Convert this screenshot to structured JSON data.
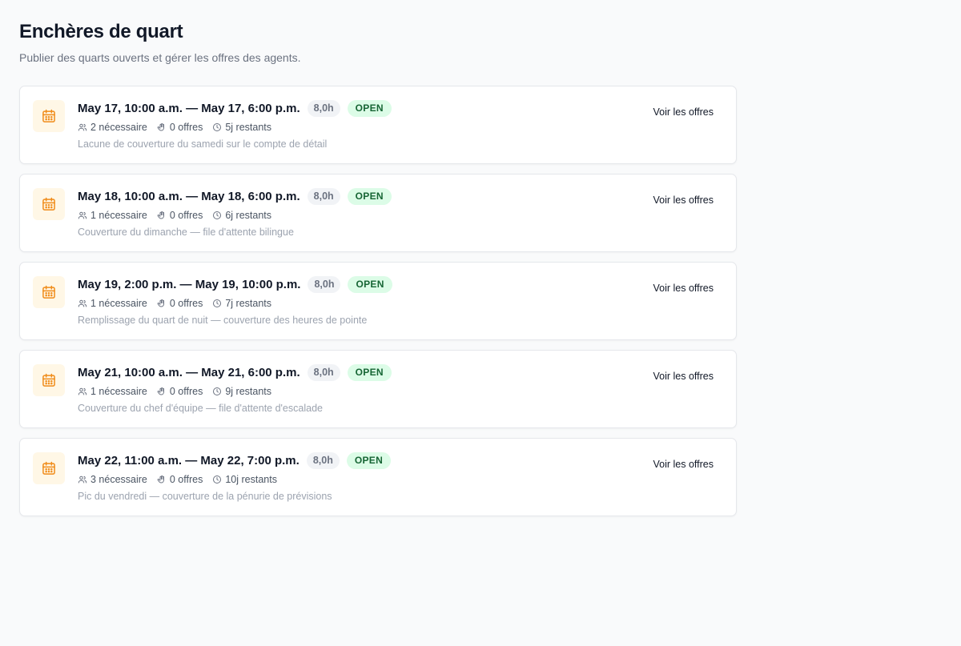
{
  "header": {
    "title": "Enchères de quart",
    "subtitle": "Publier des quarts ouverts et gérer les offres des agents."
  },
  "colors": {
    "accent_icon": "#f08c1a",
    "icon_bg": "#fff7e6",
    "open_bg": "#dcfce7",
    "open_text": "#166534"
  },
  "shifts": [
    {
      "title": "May 17, 10:00 a.m. — May 17, 6:00 p.m.",
      "hours": "8,0h",
      "status": "OPEN",
      "needed": "2 nécessaire",
      "offers": "0 offres",
      "remaining": "5j restants",
      "note": "Lacune de couverture du samedi sur le compte de détail",
      "action": "Voir les offres"
    },
    {
      "title": "May 18, 10:00 a.m. — May 18, 6:00 p.m.",
      "hours": "8,0h",
      "status": "OPEN",
      "needed": "1 nécessaire",
      "offers": "0 offres",
      "remaining": "6j restants",
      "note": "Couverture du dimanche — file d'attente bilingue",
      "action": "Voir les offres"
    },
    {
      "title": "May 19, 2:00 p.m. — May 19, 10:00 p.m.",
      "hours": "8,0h",
      "status": "OPEN",
      "needed": "1 nécessaire",
      "offers": "0 offres",
      "remaining": "7j restants",
      "note": "Remplissage du quart de nuit — couverture des heures de pointe",
      "action": "Voir les offres"
    },
    {
      "title": "May 21, 10:00 a.m. — May 21, 6:00 p.m.",
      "hours": "8,0h",
      "status": "OPEN",
      "needed": "1 nécessaire",
      "offers": "0 offres",
      "remaining": "9j restants",
      "note": "Couverture du chef d'équipe — file d'attente d'escalade",
      "action": "Voir les offres"
    },
    {
      "title": "May 22, 11:00 a.m. — May 22, 7:00 p.m.",
      "hours": "8,0h",
      "status": "OPEN",
      "needed": "3 nécessaire",
      "offers": "0 offres",
      "remaining": "10j restants",
      "note": "Pic du vendredi — couverture de la pénurie de prévisions",
      "action": "Voir les offres"
    }
  ]
}
